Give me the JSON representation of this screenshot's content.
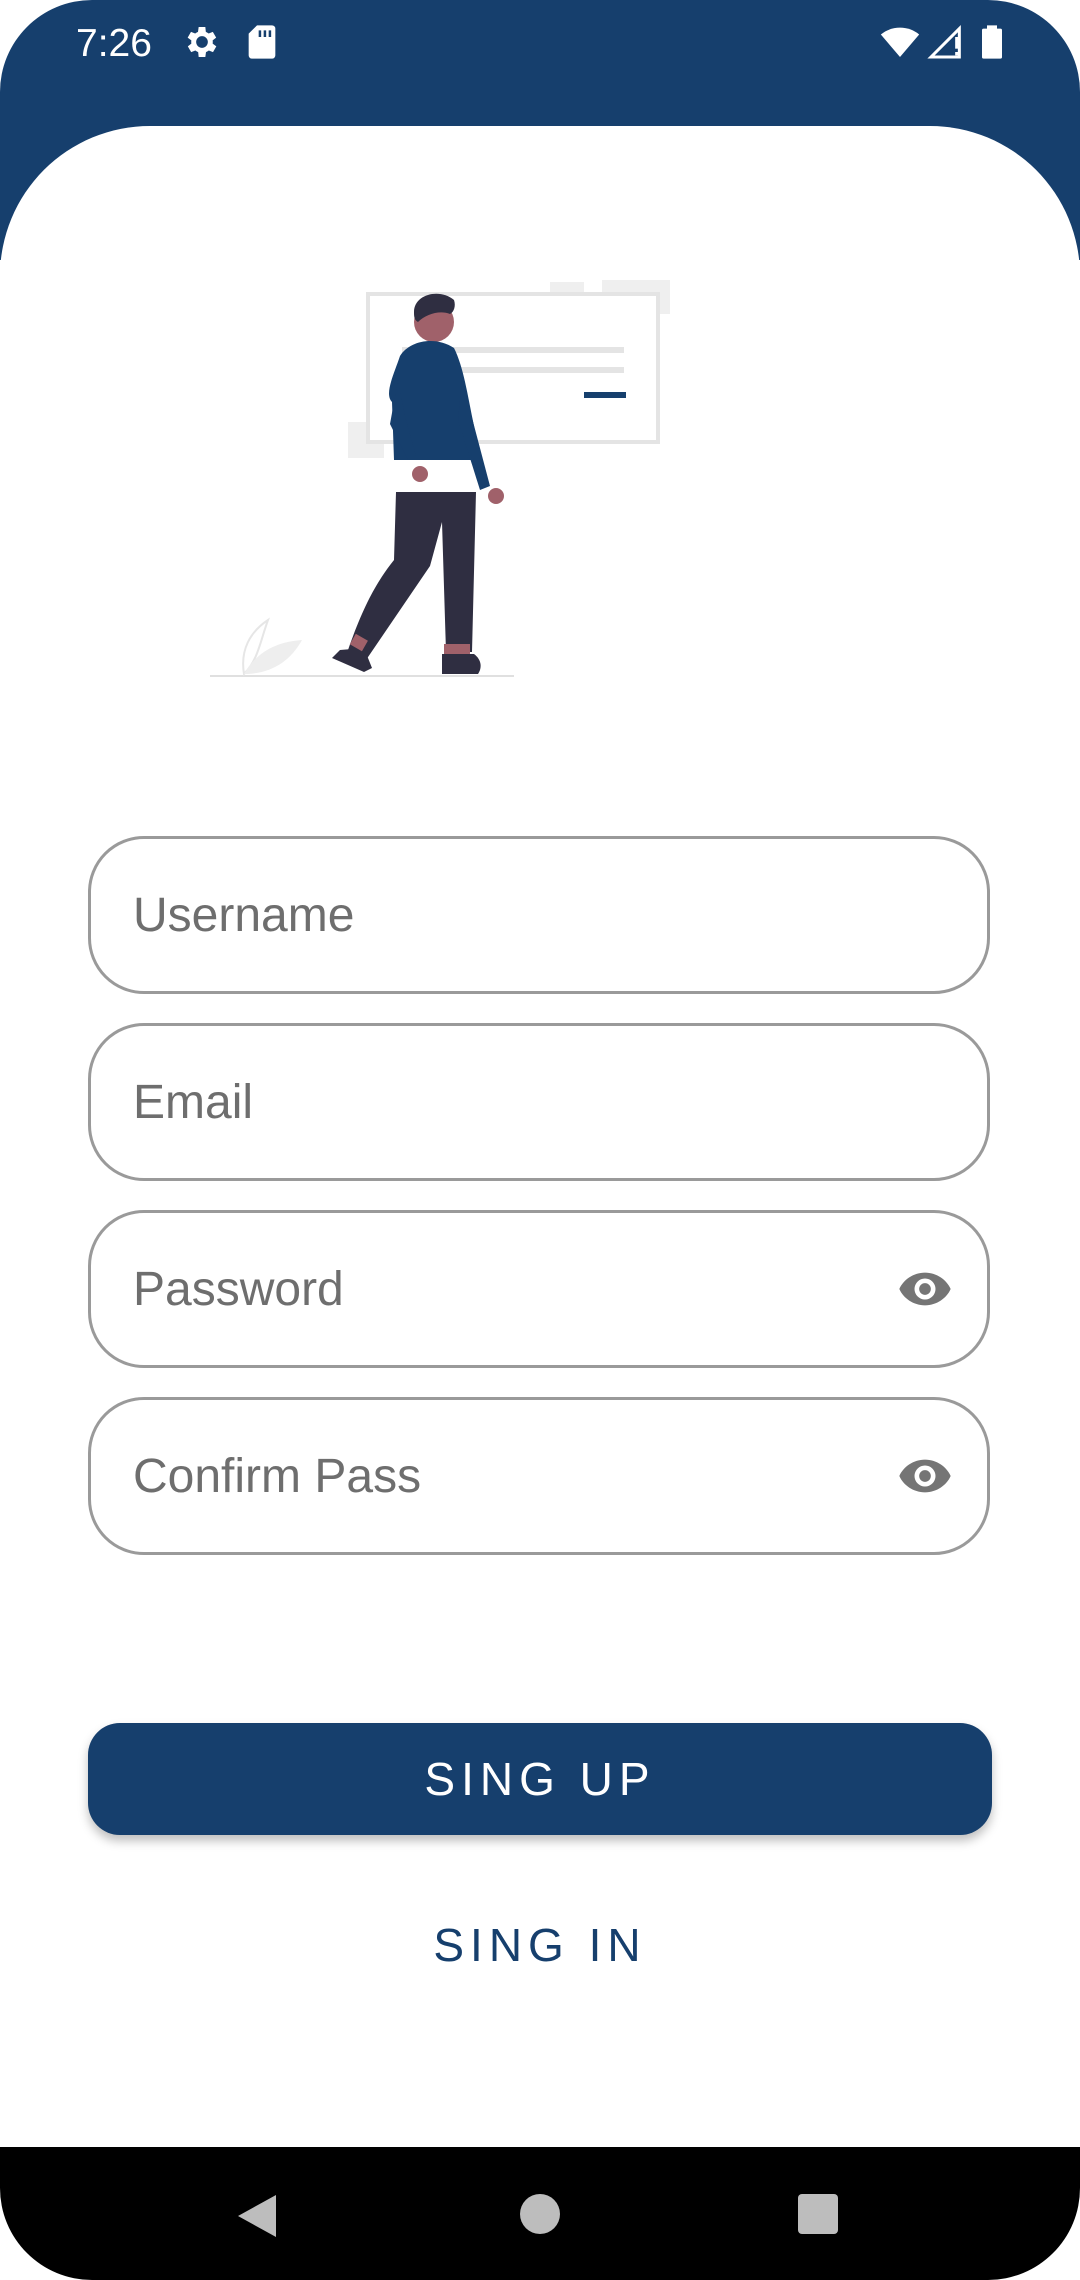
{
  "status_bar": {
    "time": "7:26",
    "left_icons": [
      "settings-icon",
      "sd-card-icon"
    ],
    "right_icons": [
      "wifi-icon",
      "signal-icon",
      "battery-icon"
    ]
  },
  "colors": {
    "primary": "#163f6d",
    "field_border": "#9a9a9a",
    "placeholder": "#6e6e6e"
  },
  "form": {
    "username_placeholder": "Username",
    "email_placeholder": "Email",
    "password_placeholder": "Password",
    "confirm_placeholder": "Confirm Pass",
    "password_toggle_icon": "eye-icon",
    "confirm_toggle_icon": "eye-icon"
  },
  "actions": {
    "sign_up_label": "SING UP",
    "sign_in_label": "SING IN"
  },
  "nav_bar": {
    "icons": [
      "back-icon",
      "home-icon",
      "recents-icon"
    ]
  }
}
